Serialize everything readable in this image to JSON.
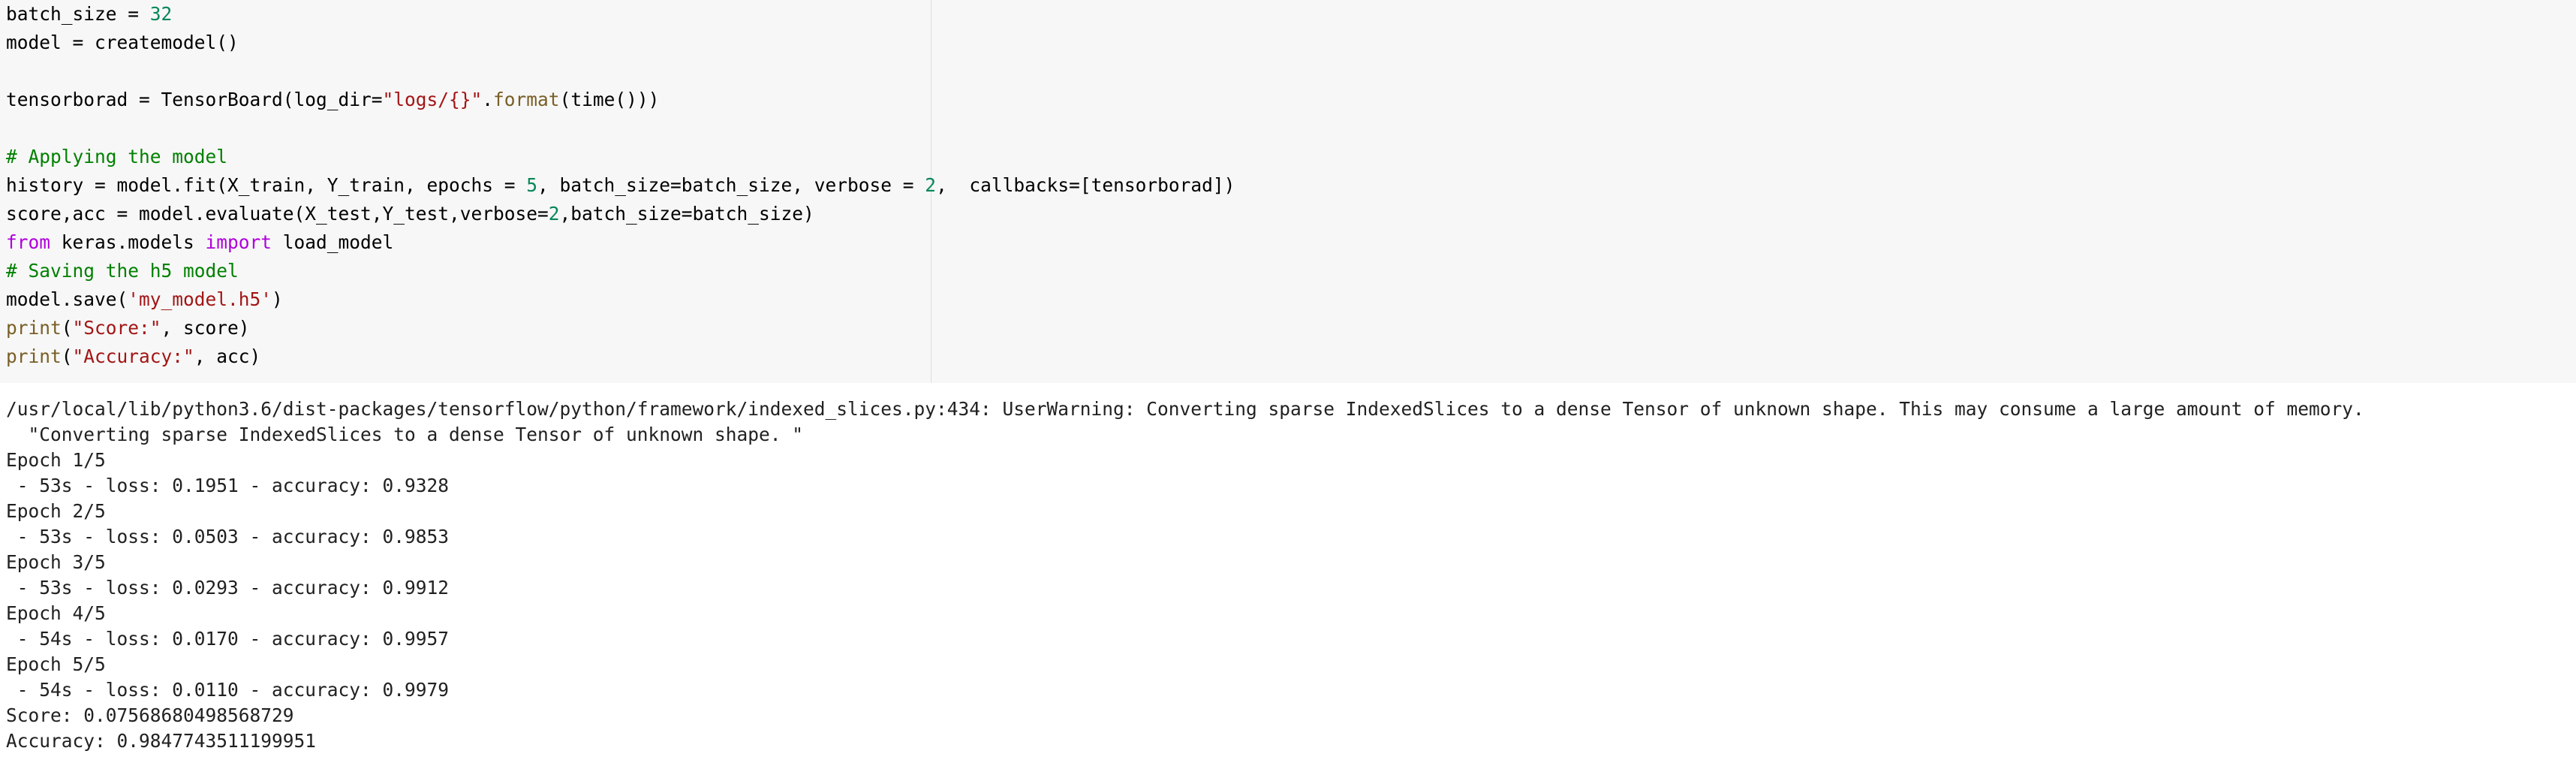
{
  "code_lines": [
    {
      "segments": [
        {
          "t": "batch_size = ",
          "c": "plain"
        },
        {
          "t": "32",
          "c": "num"
        }
      ]
    },
    {
      "segments": [
        {
          "t": "model = createmodel()",
          "c": "plain"
        }
      ]
    },
    {
      "segments": []
    },
    {
      "segments": [
        {
          "t": "tensorborad = TensorBoard(log_dir=",
          "c": "plain"
        },
        {
          "t": "\"logs/{}\"",
          "c": "str"
        },
        {
          "t": ".",
          "c": "plain"
        },
        {
          "t": "format",
          "c": "fn"
        },
        {
          "t": "(time()))",
          "c": "plain"
        }
      ]
    },
    {
      "segments": []
    },
    {
      "segments": [
        {
          "t": "# Applying the model",
          "c": "cm"
        }
      ]
    },
    {
      "segments": [
        {
          "t": "history = model.fit(X_train, Y_train, epochs = ",
          "c": "plain"
        },
        {
          "t": "5",
          "c": "num"
        },
        {
          "t": ", batch_size=batch_size, verbose = ",
          "c": "plain"
        },
        {
          "t": "2",
          "c": "num"
        },
        {
          "t": ",  callbacks=[tensorborad])",
          "c": "plain"
        }
      ]
    },
    {
      "segments": [
        {
          "t": "score,acc = model.evaluate(X_test,Y_test,verbose=",
          "c": "plain"
        },
        {
          "t": "2",
          "c": "num"
        },
        {
          "t": ",batch_size=batch_size)",
          "c": "plain"
        }
      ]
    },
    {
      "segments": [
        {
          "t": "from",
          "c": "kw"
        },
        {
          "t": " keras.models ",
          "c": "plain"
        },
        {
          "t": "import",
          "c": "kw"
        },
        {
          "t": " load_model",
          "c": "plain"
        }
      ]
    },
    {
      "segments": [
        {
          "t": "# Saving the h5 model",
          "c": "cm"
        }
      ]
    },
    {
      "segments": [
        {
          "t": "model.save(",
          "c": "plain"
        },
        {
          "t": "'my_model.h5'",
          "c": "str"
        },
        {
          "t": ")",
          "c": "plain"
        }
      ]
    },
    {
      "segments": [
        {
          "t": "print",
          "c": "fn"
        },
        {
          "t": "(",
          "c": "plain"
        },
        {
          "t": "\"Score:\"",
          "c": "str"
        },
        {
          "t": ", score)",
          "c": "plain"
        }
      ]
    },
    {
      "segments": [
        {
          "t": "print",
          "c": "fn"
        },
        {
          "t": "(",
          "c": "plain"
        },
        {
          "t": "\"Accuracy:\"",
          "c": "str"
        },
        {
          "t": ", acc)",
          "c": "plain"
        }
      ]
    }
  ],
  "output_lines": [
    "/usr/local/lib/python3.6/dist-packages/tensorflow/python/framework/indexed_slices.py:434: UserWarning: Converting sparse IndexedSlices to a dense Tensor of unknown shape. This may consume a large amount of memory.",
    "  \"Converting sparse IndexedSlices to a dense Tensor of unknown shape. \"",
    "Epoch 1/5",
    " - 53s - loss: 0.1951 - accuracy: 0.9328",
    "Epoch 2/5",
    " - 53s - loss: 0.0503 - accuracy: 0.9853",
    "Epoch 3/5",
    " - 53s - loss: 0.0293 - accuracy: 0.9912",
    "Epoch 4/5",
    " - 54s - loss: 0.0170 - accuracy: 0.9957",
    "Epoch 5/5",
    " - 54s - loss: 0.0110 - accuracy: 0.9979",
    "Score: 0.07568680498568729",
    "Accuracy: 0.9847743511199951"
  ],
  "colors": {
    "code_background": "#f7f7f7",
    "keyword": "#af00db",
    "string": "#a31515",
    "number": "#098658",
    "function": "#795e26",
    "comment": "#008000"
  }
}
